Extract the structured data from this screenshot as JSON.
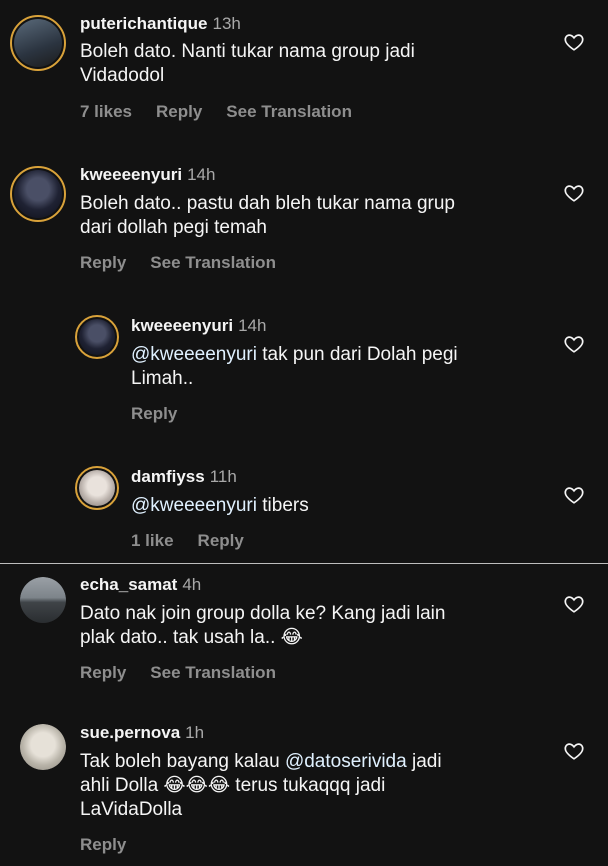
{
  "comments": [
    {
      "username": "puterichantique",
      "time": "13h",
      "text_lines": [
        "Boleh dato. Nanti tukar nama group jadi",
        "Vidadodol"
      ],
      "likes": "7 likes",
      "reply": "Reply",
      "see_translation": "See Translation"
    },
    {
      "username": "kweeeenyuri",
      "time": "14h",
      "text_lines": [
        "Boleh dato.. pastu dah bleh tukar nama grup",
        "dari dollah pegi temah"
      ],
      "reply": "Reply",
      "see_translation": "See Translation"
    },
    {
      "username": "kweeeenyuri",
      "time": "14h",
      "mention": "@kweeeenyuri",
      "text_lines": [
        " tak pun dari Dolah pegi",
        "Limah.."
      ],
      "reply": "Reply"
    },
    {
      "username": "damfiyss",
      "time": "11h",
      "mention": "@kweeeenyuri",
      "text_lines": [
        " tibers"
      ],
      "likes": "1 like",
      "reply": "Reply"
    },
    {
      "username": "echa_samat",
      "time": "4h",
      "text_lines": [
        "Dato nak join group dolla ke? Kang jadi lain",
        "plak dato.. tak usah la.. 😂"
      ],
      "reply": "Reply",
      "see_translation": "See Translation"
    },
    {
      "username": "sue.pernova",
      "time": "1h",
      "mention": "@datoserivida",
      "text_prefix": "Tak boleh bayang kalau ",
      "text_lines": [
        " jadi",
        "ahli Dolla 😂😂😂 terus tukaqqq jadi",
        "LaVidaDolla"
      ],
      "reply": "Reply"
    }
  ],
  "colors": {
    "background": "#121212",
    "text": "#f5f5f5",
    "secondary": "#8e8e8e",
    "mention": "#e0f1ff",
    "ring": "#d9a23a"
  },
  "icons": {
    "like": "heart-outline-icon"
  }
}
